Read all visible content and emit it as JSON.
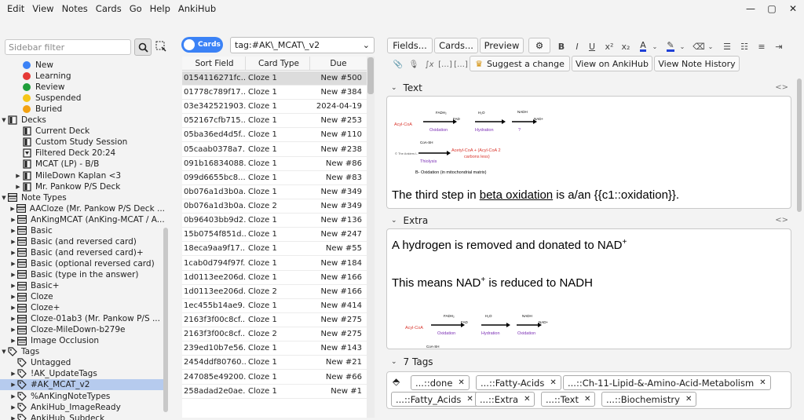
{
  "menubar": [
    "Edit",
    "View",
    "Notes",
    "Cards",
    "Go",
    "Help",
    "AnkiHub"
  ],
  "window_controls": [
    "—",
    "▢",
    "✕"
  ],
  "sidebar": {
    "filter_placeholder": "Sidebar filter",
    "card_states": [
      {
        "label": "New",
        "color": "#3b82f6"
      },
      {
        "label": "Learning",
        "color": "#e53935"
      },
      {
        "label": "Review",
        "color": "#1e9e3a"
      },
      {
        "label": "Suspended",
        "color": "#f5c518"
      },
      {
        "label": "Buried",
        "color": "#f2a112"
      }
    ],
    "decks_header": "Decks",
    "decks": [
      "Current Deck",
      "Custom Study Session",
      "Filtered Deck 20:24",
      "MCAT (LP) - B/B",
      "MileDown Kaplan <3",
      "Mr. Pankow P/S Deck"
    ],
    "note_types_header": "Note Types",
    "note_types": [
      "AACloze (Mr. Pankow P/S Deck ...",
      "AnKingMCAT (AnKing-MCAT / A...",
      "Basic",
      "Basic (and reversed card)",
      "Basic (and reversed card)+",
      "Basic (optional reversed card)",
      "Basic (type in the answer)",
      "Basic+",
      "Cloze",
      "Cloze+",
      "Cloze-01ab3 (Mr. Pankow P/S ...",
      "Cloze-MileDown-b279e",
      "Image Occlusion"
    ],
    "tags_header": "Tags",
    "tags": [
      "Untagged",
      "!AK_UpdateTags",
      "#AK_MCAT_v2",
      "%AnKingNoteTypes",
      "AnkiHub_ImageReady",
      "AnkiHub_Subdeck"
    ]
  },
  "browser": {
    "mode_label": "Cards",
    "search_query": "tag:#AK\\_MCAT\\_v2",
    "columns": [
      "Sort Field",
      "Card Type",
      "Due"
    ],
    "rows": [
      [
        "0154116271fc...",
        "Cloze 1",
        "New #500"
      ],
      [
        "01778c789f17...",
        "Cloze 1",
        "New #384"
      ],
      [
        "03e342521903...",
        "Cloze 1",
        "2024-04-19"
      ],
      [
        "052167cfb715...",
        "Cloze 1",
        "New #253"
      ],
      [
        "05ba36ed4d5f...",
        "Cloze 1",
        "New #110"
      ],
      [
        "05caab0378a7...",
        "Cloze 1",
        "New #238"
      ],
      [
        "091b16834088...",
        "Cloze 1",
        "New #86"
      ],
      [
        "099d6655bc8...",
        "Cloze 1",
        "New #83"
      ],
      [
        "0b076a1d3b0a...",
        "Cloze 1",
        "New #349"
      ],
      [
        "0b076a1d3b0a...",
        "Cloze 2",
        "New #349"
      ],
      [
        "0b96403bb9d2...",
        "Cloze 1",
        "New #136"
      ],
      [
        "15b0754f851d...",
        "Cloze 1",
        "New #247"
      ],
      [
        "18eca9aa9f17...",
        "Cloze 1",
        "New #55"
      ],
      [
        "1cab0d794f97f...",
        "Cloze 1",
        "New #184"
      ],
      [
        "1d0113ee206d...",
        "Cloze 1",
        "New #166"
      ],
      [
        "1d0113ee206d...",
        "Cloze 2",
        "New #166"
      ],
      [
        "1ec455b14ae9...",
        "Cloze 1",
        "New #414"
      ],
      [
        "2163f3f00c8cf...",
        "Cloze 1",
        "New #275"
      ],
      [
        "2163f3f00c8cf...",
        "Cloze 2",
        "New #275"
      ],
      [
        "239ed10b7e56...",
        "Cloze 1",
        "New #143"
      ],
      [
        "2454ddf80760...",
        "Cloze 1",
        "New #21"
      ],
      [
        "247085e49200...",
        "Cloze 1",
        "New #66"
      ],
      [
        "258adad2e0ae...",
        "Cloze 1",
        "New #1"
      ]
    ]
  },
  "editor": {
    "toolbar": {
      "fields": "Fields...",
      "cards": "Cards...",
      "preview": "Preview"
    },
    "format_buttons": [
      "B",
      "I",
      "U",
      "x²",
      "x₂"
    ],
    "secondary": {
      "suggest": "Suggest a change",
      "view_ankihub": "View on AnkiHub",
      "history": "View Note History"
    },
    "text_label": "Text",
    "extra_label": "Extra",
    "text_field": {
      "before": "The third step in ",
      "link": "beta oxidation",
      "after": " is a/an {{c1::oxidation}}."
    },
    "extra_field": {
      "line1": "A hydrogen is removed and donated to NAD",
      "line2_a": "This means NAD",
      "line2_b": " is reduced to NADH",
      "sup": "+"
    },
    "diagram": {
      "acyl": "Acyl-CoA",
      "fadh": "FADH₂",
      "fad": "FAD",
      "h2o": "H₂O",
      "nadh": "NADH",
      "nad": "NAD+",
      "oxidation": "Oxidation",
      "hydration": "Hydration",
      "q": "?",
      "coash": "CoA-SH",
      "thiolysis": "Thiolysis",
      "products": "Acetyl-CoA + (Acyl-CoA 2",
      "products2": "carbons less)",
      "caption": "B- Oxidation (in mitochondrial matrix)",
      "credit": "© The Ankiers L."
    },
    "tags_header": "7 Tags",
    "tags": [
      "...::done",
      "...::Fatty-Acids",
      "...::Ch-11-Lipid-&-Amino-Acid-Metabolism",
      "...::Fatty_Acids",
      "...::Extra",
      "...::Text",
      "...::Biochemistry"
    ]
  },
  "colors": {
    "accent": "#3b82f6",
    "selected_row": "#b6cbee",
    "diagram_red": "#d9342b",
    "diagram_purple": "#7b2fb5"
  }
}
